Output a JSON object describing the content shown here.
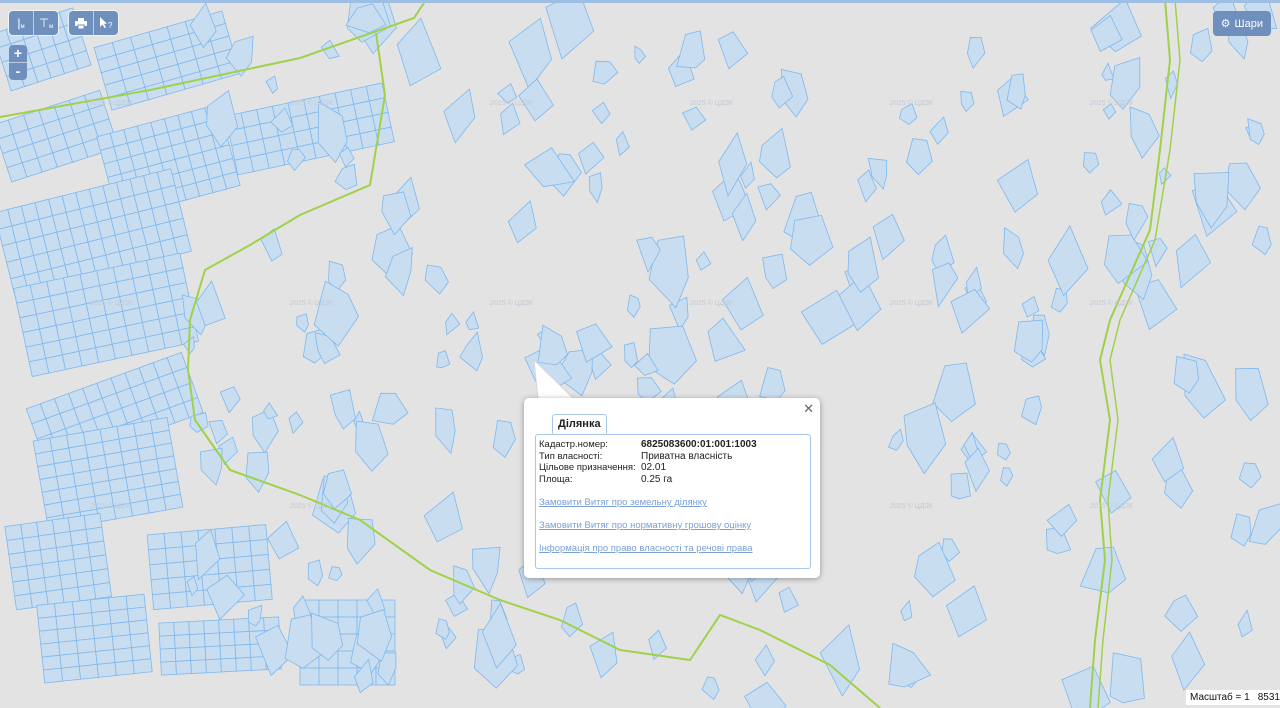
{
  "colors": {
    "background": "#e3e3e3",
    "parcel_fill": "#c9ddf0",
    "parcel_stroke": "#7fb8ee",
    "boundary": "#9fd14a",
    "toolbar": "#6f8fbd",
    "link": "#7aa0d4"
  },
  "toolbar": {
    "measure_line": {
      "icon": "ruler-line-icon",
      "sub": "м"
    },
    "measure_area": {
      "icon": "ruler-area-icon",
      "sub": "м"
    },
    "print": {
      "icon": "print-icon"
    },
    "identify": {
      "icon": "cursor-help-icon"
    }
  },
  "zoom": {
    "in": "+",
    "out": "-"
  },
  "layers": {
    "label": "Шари",
    "icon": "gear-icon"
  },
  "watermark_text": "2015 © ЦДЗК",
  "popup": {
    "tab": "Ділянка",
    "fields": [
      {
        "label": "Кадастр.номер:",
        "value": "6825083600:01:001:1003"
      },
      {
        "label": "Тип власності:",
        "value": "Приватна власність"
      },
      {
        "label": "Цільове призначення:",
        "value": "02.01"
      },
      {
        "label": "Площа:",
        "value": "0.25 га"
      }
    ],
    "links": [
      "Замовити Витяг про земельну ділянку",
      "Замовити Витяг про нормативну грошову оцінку",
      "Інформація про право власності та речові права"
    ]
  },
  "scale": {
    "label": "Масштаб = 1",
    "value": "8531"
  }
}
